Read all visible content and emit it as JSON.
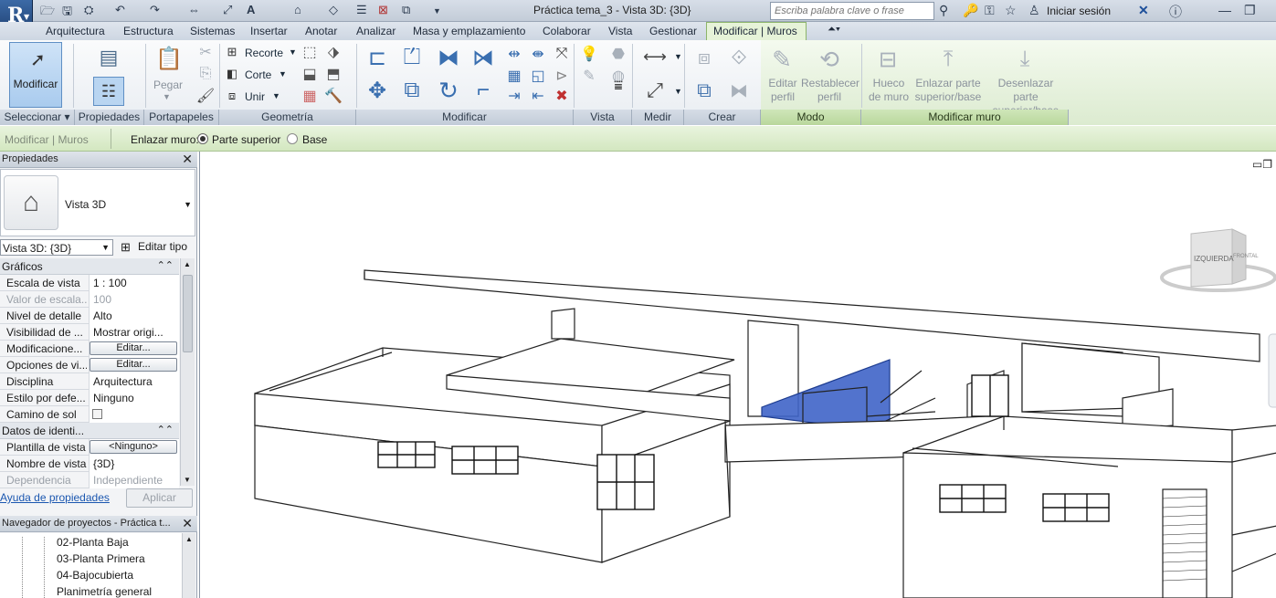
{
  "window": {
    "title": "Práctica tema_3 - Vista 3D: {3D}",
    "search_placeholder": "Escriba palabra clave o frase",
    "login": "Iniciar sesión",
    "app_letter": "R"
  },
  "tabs": [
    "Arquitectura",
    "Estructura",
    "Sistemas",
    "Insertar",
    "Anotar",
    "Analizar",
    "Masa y emplazamiento",
    "Colaborar",
    "Vista",
    "Gestionar",
    "Modificar | Muros"
  ],
  "ribbon": {
    "modificar_label": "Modificar",
    "pegar_label": "Pegar",
    "recorte": "Recorte",
    "corte": "Corte",
    "unir": "Unir",
    "editar_perfil": [
      "Editar",
      "perfil"
    ],
    "restablecer_perfil": [
      "Restablecer",
      "perfil"
    ],
    "hueco_muro": [
      "Hueco",
      "de muro"
    ],
    "enlazar": [
      "Enlazar parte",
      "superior/base"
    ],
    "desenlazar": [
      "Desenlazar parte",
      "superior/base"
    ],
    "panels": {
      "seleccionar": "Seleccionar ▾",
      "propiedades": "Propiedades",
      "portapapeles": "Portapapeles",
      "geometria": "Geometría",
      "modificar": "Modificar",
      "vista": "Vista",
      "medir": "Medir",
      "crear": "Crear",
      "modo": "Modo",
      "modificar_muro": "Modificar muro"
    }
  },
  "optionsbar": {
    "context": "Modificar | Muros",
    "enlazar": "Enlazar muro:",
    "opt1": "Parte superior",
    "opt2": "Base"
  },
  "properties": {
    "title": "Propiedades",
    "type_name": "Vista 3D",
    "selector": "Vista 3D: {3D}",
    "edit_type": "Editar tipo",
    "group1": "Gráficos",
    "rows1": [
      {
        "k": "Escala de vista",
        "v": "1 : 100"
      },
      {
        "k": "Valor de escala...",
        "v": "100"
      },
      {
        "k": "Nivel de detalle",
        "v": "Alto"
      },
      {
        "k": "Visibilidad de ...",
        "v": "Mostrar origi..."
      },
      {
        "k": "Modificacione...",
        "v": "Editar..."
      },
      {
        "k": "Opciones de vi...",
        "v": "Editar..."
      },
      {
        "k": "Disciplina",
        "v": "Arquitectura"
      },
      {
        "k": "Estilo por defe...",
        "v": "Ninguno"
      },
      {
        "k": "Camino de sol",
        "v": ""
      }
    ],
    "group2": "Datos de identi...",
    "rows2": [
      {
        "k": "Plantilla de vista",
        "v": "<Ninguno>"
      },
      {
        "k": "Nombre de vista",
        "v": "{3D}"
      },
      {
        "k": "Dependencia",
        "v": "Independiente"
      }
    ],
    "help": "Ayuda de propiedades",
    "apply": "Aplicar"
  },
  "browser": {
    "title": "Navegador de proyectos - Práctica t...",
    "items": [
      "02-Planta Baja",
      "03-Planta Primera",
      "04-Bajocubierta",
      "Planimetría general"
    ]
  },
  "viewcube": {
    "left": "IZQUIERDA",
    "front": "FRONTAL"
  }
}
